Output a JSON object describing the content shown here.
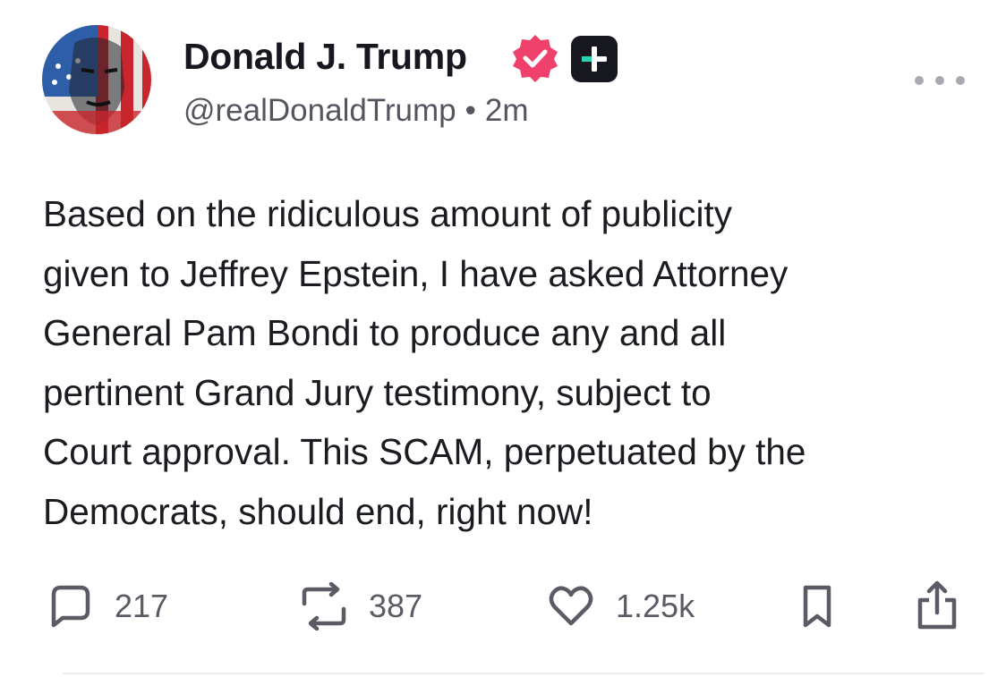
{
  "author": {
    "display_name": "Donald J. Trump",
    "handle": "@realDonaldTrump",
    "separator": "•",
    "timestamp": "2m",
    "verified_color": "#f0416c"
  },
  "post": {
    "lines": [
      "Based on the ridiculous amount of publicity",
      "given to Jeffrey Epstein, I have asked Attorney",
      "General Pam Bondi to produce any and all",
      "pertinent Grand Jury testimony, subject to",
      "Court approval. This SCAM, perpetuated by the",
      "Democrats, should end, right now!"
    ]
  },
  "actions": {
    "replies": "217",
    "reposts": "387",
    "likes": "1.25k"
  },
  "icons": {
    "verified": "verified-badge-icon",
    "plus": "plus-badge-icon",
    "more": "more-horizontal-icon",
    "reply": "comment-icon",
    "repost": "repost-icon",
    "like": "heart-icon",
    "bookmark": "bookmark-icon",
    "share": "share-icon"
  }
}
